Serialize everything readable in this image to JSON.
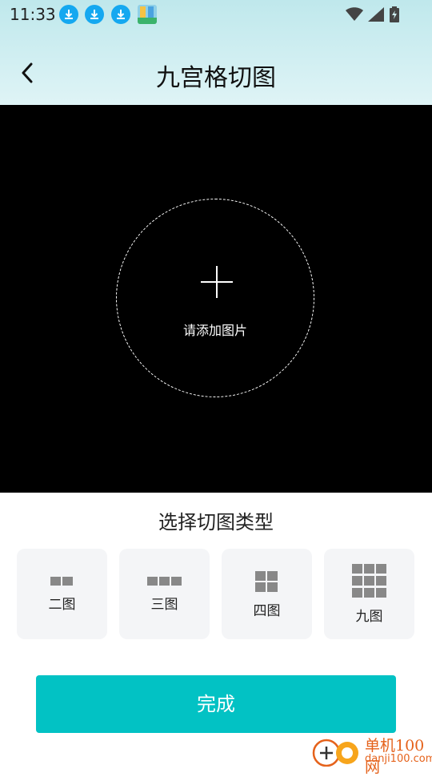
{
  "status_bar": {
    "time": "11:33",
    "icons": [
      "download-icon",
      "download-icon",
      "download-icon",
      "app-icon",
      "wifi-icon",
      "signal-icon",
      "battery-icon"
    ]
  },
  "header": {
    "title": "九宫格切图",
    "back_icon": "back-icon"
  },
  "canvas": {
    "add_label": "请添加图片",
    "add_icon": "plus-icon"
  },
  "split_type": {
    "title": "选择切图类型",
    "options": [
      {
        "label": "二图"
      },
      {
        "label": "三图"
      },
      {
        "label": "四图"
      },
      {
        "label": "九图"
      }
    ]
  },
  "done_button": {
    "label": "完成"
  },
  "watermark": {
    "cn": "单机100网",
    "url": "danji100.com"
  },
  "colors": {
    "accent": "#02c2c4",
    "header_bg": "#cdeef1",
    "canvas_bg": "#000000",
    "option_bg": "#f4f5f7",
    "grid_icon": "#888888"
  }
}
